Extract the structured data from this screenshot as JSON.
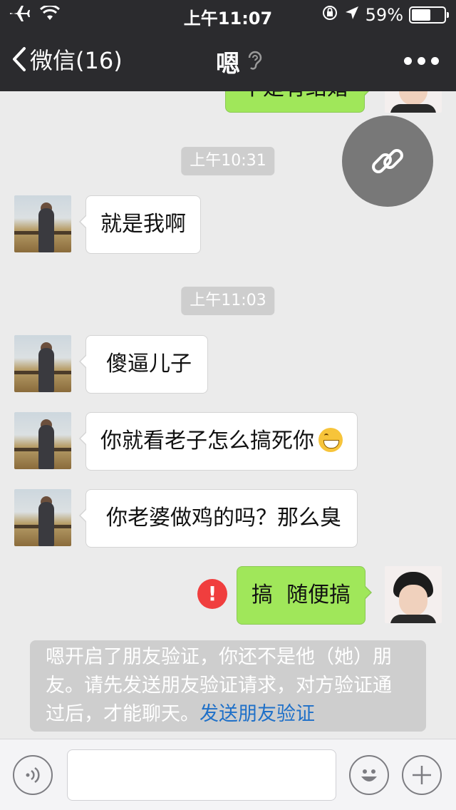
{
  "status_bar": {
    "time": "上午11:07",
    "battery_text": "59%",
    "battery_level": 0.59,
    "icons": [
      "airplane-icon",
      "wifi-icon",
      "orientation-lock-icon",
      "location-arrow-icon",
      "battery-icon"
    ]
  },
  "nav": {
    "back_label": "微信(16)",
    "title": "嗯",
    "title_icon": "earpiece-icon",
    "more_icon": "more-dots-icon"
  },
  "chat": {
    "partial_top_text": "不是有结婚",
    "timestamps": [
      "上午10:31",
      "上午11:03"
    ],
    "messages": [
      {
        "side": "left",
        "text": "就是我啊"
      },
      {
        "side": "left",
        "text": "傻逼儿子"
      },
      {
        "side": "left",
        "text": "你就看老子怎么搞死你",
        "emoji": "grinning-emoji-icon"
      },
      {
        "side": "left",
        "text": "你老婆做鸡的吗？那么臭"
      },
      {
        "side": "right",
        "text": "搞  随便搞",
        "status": "failed"
      }
    ],
    "fail_mark": "!",
    "system_notice": {
      "text": "嗯开启了朋友验证，你还不是他（她）朋友。请先发送朋友验证请求，对方验证通过后，才能聊天。",
      "link": "发送朋友验证"
    }
  },
  "floating_button": {
    "icon": "link-icon"
  },
  "input_bar": {
    "voice_icon": "voice-icon",
    "emoji_icon": "emoji-icon",
    "plus_icon": "plus-icon",
    "input_value": ""
  },
  "colors": {
    "nav_bg": "#2b2b2e",
    "chat_bg": "#ebebeb",
    "self_bubble": "#a0e75a",
    "other_bubble": "#ffffff",
    "link": "#1f70c8",
    "error": "#f03e3e"
  }
}
